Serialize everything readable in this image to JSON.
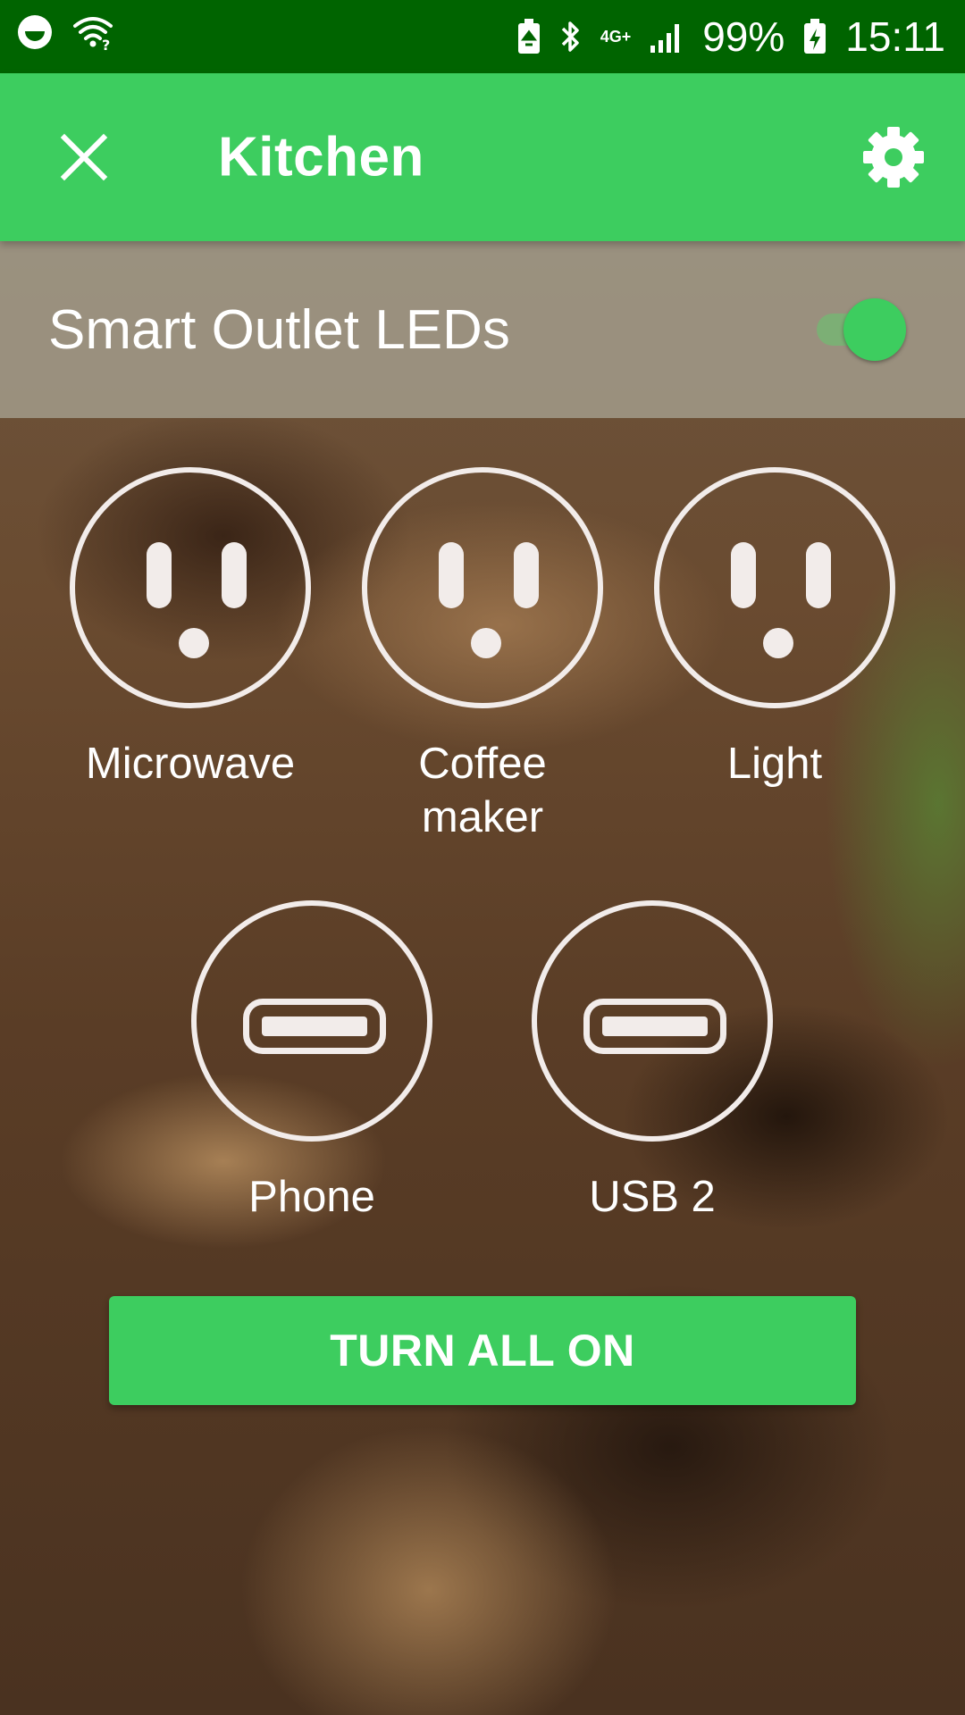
{
  "status_bar": {
    "battery_percent": "99%",
    "time": "15:11",
    "network_type": "4G+",
    "icons": [
      "smiley-icon",
      "wifi-question-icon",
      "battery-saver-icon",
      "bluetooth-icon",
      "network-4g-icon",
      "signal-icon",
      "battery-charging-icon"
    ]
  },
  "toolbar": {
    "title": "Kitchen",
    "close_icon": "close-icon",
    "settings_icon": "gear-icon"
  },
  "led_setting": {
    "label": "Smart Outlet LEDs",
    "enabled": true
  },
  "outlets": [
    {
      "label": "Microwave",
      "type": "ac",
      "icon": "ac-outlet-icon"
    },
    {
      "label": "Coffee maker",
      "type": "ac",
      "icon": "ac-outlet-icon"
    },
    {
      "label": "Light",
      "type": "ac",
      "icon": "ac-outlet-icon"
    },
    {
      "label": "Phone",
      "type": "usb",
      "icon": "usb-port-icon"
    },
    {
      "label": "USB 2",
      "type": "usb",
      "icon": "usb-port-icon"
    }
  ],
  "actions": {
    "turn_all_label": "TURN ALL ON"
  },
  "colors": {
    "accent": "#3dcd5f",
    "status_bar": "#006400",
    "outlet_stroke": "#f2ecea"
  }
}
